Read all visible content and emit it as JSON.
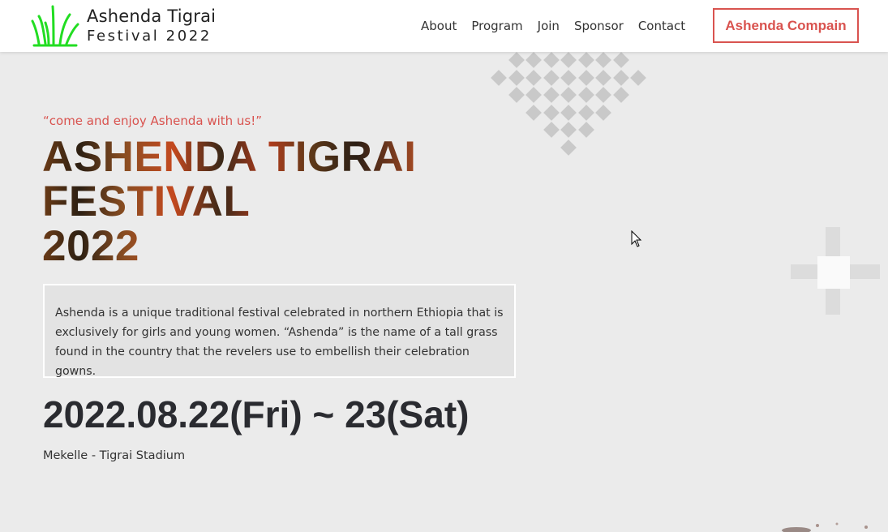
{
  "header": {
    "brand_line1": "Ashenda Tigrai",
    "brand_line2": "Festival 2022",
    "logo_icon": "grass-icon",
    "nav": [
      {
        "label": "About"
      },
      {
        "label": "Program"
      },
      {
        "label": "Join"
      },
      {
        "label": "Sponsor"
      },
      {
        "label": "Contact"
      }
    ],
    "cta_label": "Ashenda Compain"
  },
  "hero": {
    "tagline": "“come and enjoy Ashenda with us!”",
    "title_lines": [
      "ASHENDA TIGRAI",
      "FESTIVAL",
      "2022"
    ],
    "description": "Ashenda is a unique traditional festival celebrated in northern Ethiopia that is exclusively for girls and young women. “Ashenda” is the name of a tall grass found in the country that the revelers use to embellish their celebration gowns.",
    "date": "2022.08.22(Fri) ~ 23(Sat)",
    "venue": "Mekelle - Tigrai Stadium"
  },
  "colors": {
    "accent": "#d9534f",
    "logo_green": "#2ecc40",
    "background": "#ebebeb"
  }
}
